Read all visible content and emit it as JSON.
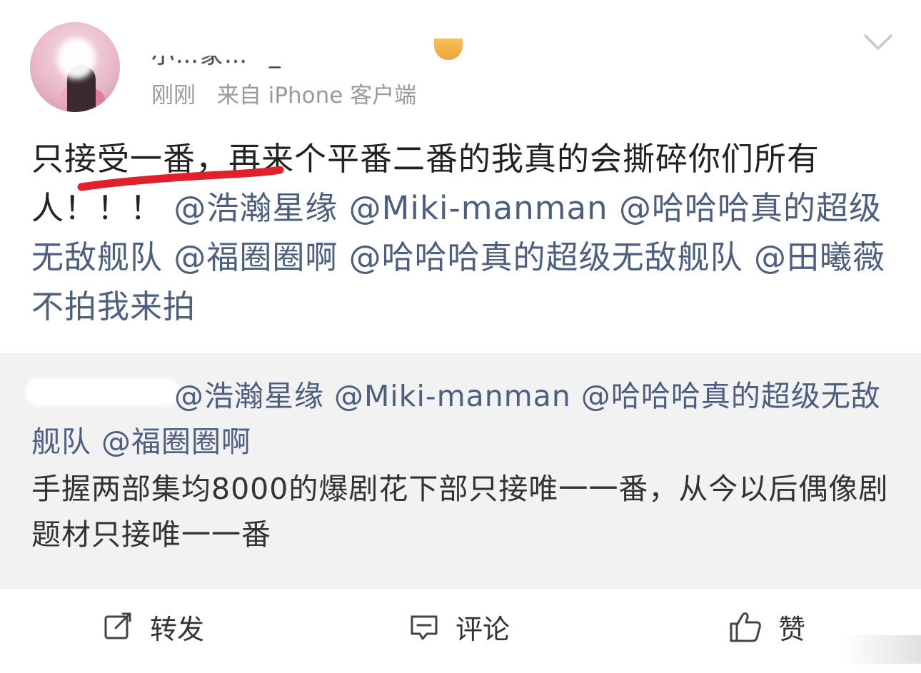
{
  "post": {
    "username": "小…家…^_^",
    "meta": {
      "time": "刚刚",
      "source": "来自 iPhone 客户端"
    },
    "content": {
      "text": "只接受一番，再来个平番二番的我真的会撕碎你们所有人！！！",
      "mentions": [
        "@浩瀚星缘",
        "@Miki-manman",
        "@哈哈哈真的超级无敌舰队",
        "@福圈圈啊",
        "@哈哈哈真的超级无敌舰队",
        "@田曦薇不拍我来拍"
      ]
    },
    "repost": {
      "mentions_line": "@浩瀚星缘 @Miki-manman @哈哈哈真的超级无敌舰队 @福圈圈啊",
      "text": "手握两部集均8000的爆剧花下部只接唯一一番，从今以后偶像剧题材只接唯一一番"
    },
    "actions": {
      "repost_label": "转发",
      "comment_label": "评论",
      "like_label": "赞"
    }
  },
  "colors": {
    "mention": "#4d5f7f",
    "meta": "#9a9a9a",
    "repost_bg": "#f2f2f2",
    "underline": "#e0202a"
  },
  "icons": {
    "repost": "edit-arrow-icon",
    "comment": "chat-bubble-icon",
    "like": "thumbs-up-icon",
    "menu": "chevron-down-icon"
  }
}
